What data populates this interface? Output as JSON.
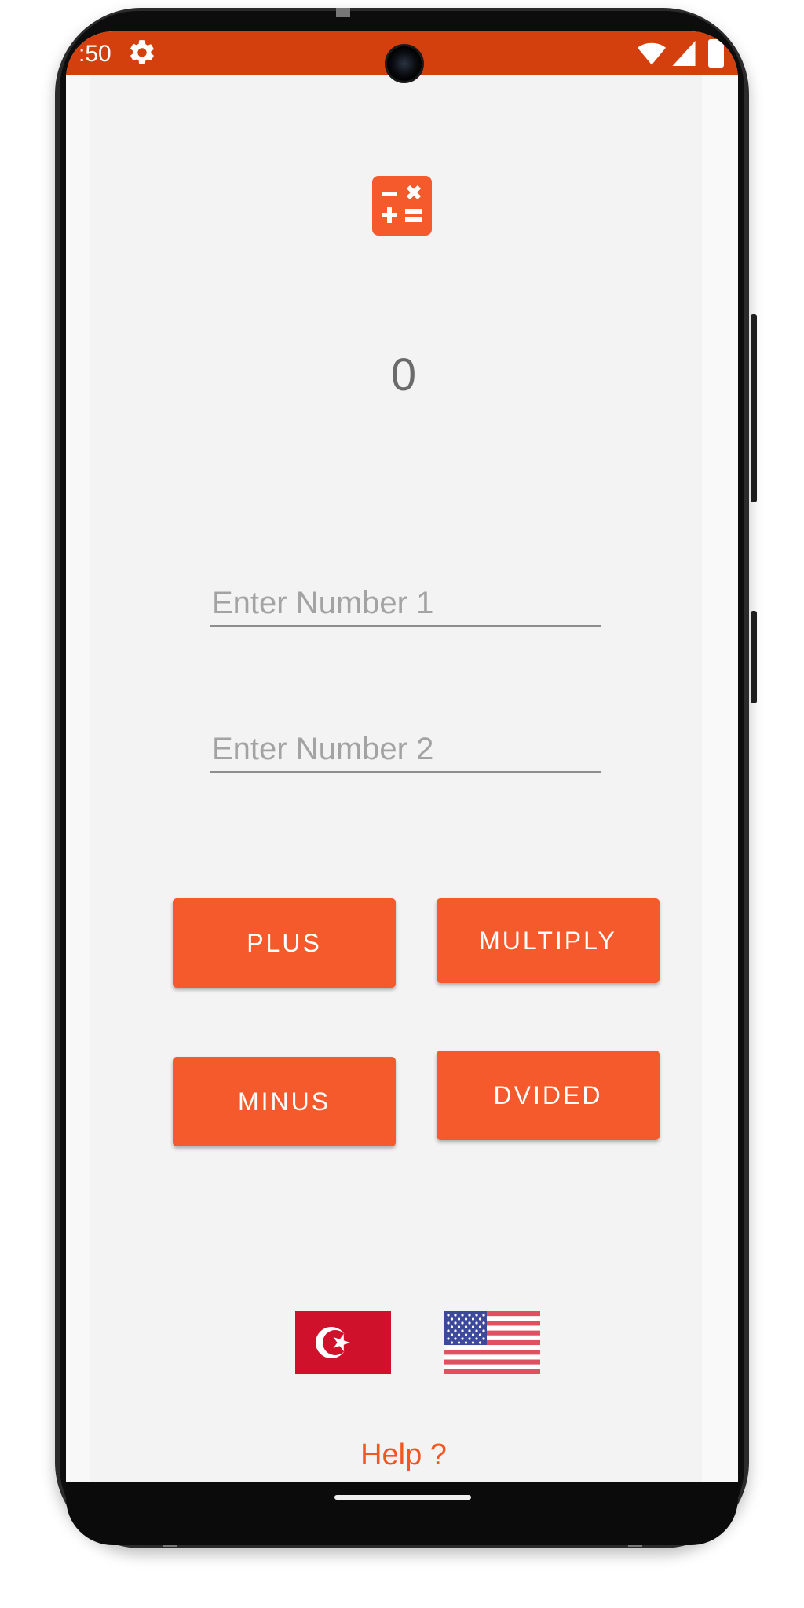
{
  "status_bar": {
    "time": ":50",
    "color": "#d3400d"
  },
  "app": {
    "logo_icon": "calculator-icon",
    "accent_color": "#f45a2b",
    "result": "0",
    "inputs": {
      "number1_placeholder": "Enter Number 1",
      "number2_placeholder": "Enter Number 2"
    },
    "buttons": {
      "plus": "PLUS",
      "multiply": "MULTIPLY",
      "minus": "MINUS",
      "divide": "DVIDED"
    },
    "languages": [
      {
        "icon": "turkey-flag-icon"
      },
      {
        "icon": "usa-flag-icon"
      }
    ],
    "help_link": "Help ?"
  }
}
